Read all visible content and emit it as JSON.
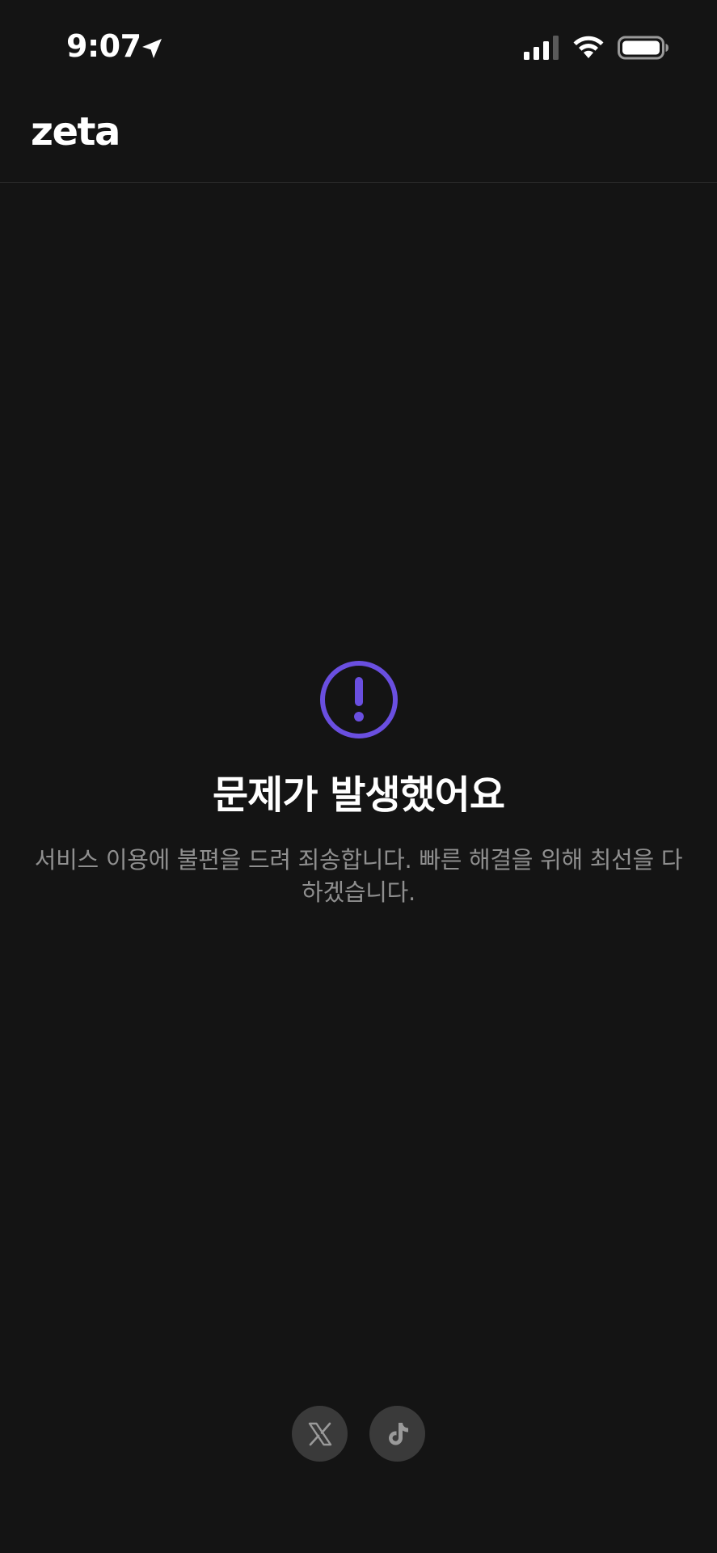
{
  "status_bar": {
    "time": "9:07"
  },
  "header": {
    "logo": "zeta"
  },
  "error": {
    "title": "문제가 발생했어요",
    "message": "서비스 이용에 불편을 드려 죄송합니다. 빠른 해결을 위해 최선을 다하겠습니다."
  },
  "colors": {
    "background": "#141414",
    "accent": "#6a4fe0",
    "message_text": "#8f8f8f",
    "social_button_bg": "#3a3a3a"
  },
  "social": {
    "icons": [
      "x-icon",
      "tiktok-icon"
    ]
  }
}
